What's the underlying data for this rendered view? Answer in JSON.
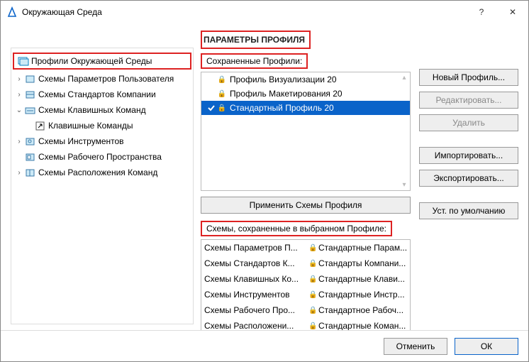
{
  "window": {
    "title": "Окружающая Среда",
    "help": "?",
    "close": "✕"
  },
  "tree": {
    "header": "Профили Окружающей Среды",
    "items": [
      {
        "exp": "›",
        "label": "Схемы Параметров Пользователя",
        "indent": 0,
        "icon": "user"
      },
      {
        "exp": "›",
        "label": "Схемы Стандартов Компании",
        "indent": 0,
        "icon": "company"
      },
      {
        "exp": "⌄",
        "label": "Схемы Клавишных Команд",
        "indent": 0,
        "icon": "keyboard"
      },
      {
        "exp": "",
        "label": "Клавишные Команды",
        "indent": 1,
        "icon": "shortcut"
      },
      {
        "exp": "›",
        "label": "Схемы Инструментов",
        "indent": 0,
        "icon": "tools"
      },
      {
        "exp": "",
        "label": "Схемы Рабочего Пространства",
        "indent": 0,
        "icon": "workspace"
      },
      {
        "exp": "›",
        "label": "Схемы Расположения Команд",
        "indent": 0,
        "icon": "layout"
      }
    ]
  },
  "main": {
    "section_title": "ПАРАМЕТРЫ ПРОФИЛЯ",
    "saved_label": "Сохраненные Профили:",
    "profiles": [
      {
        "locked": true,
        "selected": false,
        "label": "Профиль Визуализации 20"
      },
      {
        "locked": true,
        "selected": false,
        "label": "Профиль Макетирования 20"
      },
      {
        "locked": true,
        "selected": true,
        "label": "Стандартный Профиль 20"
      }
    ],
    "apply_label": "Применить Схемы Профиля",
    "schemes_label": "Схемы, сохраненные в выбранном Профиле:",
    "schemes": [
      [
        "Схемы Параметров П...",
        "Стандартные Парам..."
      ],
      [
        "Схемы Стандартов К...",
        "Стандарты Компани..."
      ],
      [
        "Схемы Клавишных Ко...",
        "Стандартные Клави..."
      ],
      [
        "Схемы Инструментов",
        "Стандартные Инстр..."
      ],
      [
        "Схемы Рабочего Про...",
        "Стандартное Рабоч..."
      ],
      [
        "Схемы Расположени...",
        "Стандартные Коман..."
      ]
    ]
  },
  "buttons": {
    "new": "Новый Профиль...",
    "edit": "Редактировать...",
    "delete": "Удалить",
    "import": "Импортировать...",
    "export": "Экспортировать...",
    "default": "Уст. по умолчанию"
  },
  "footer": {
    "cancel": "Отменить",
    "ok": "ОК"
  }
}
